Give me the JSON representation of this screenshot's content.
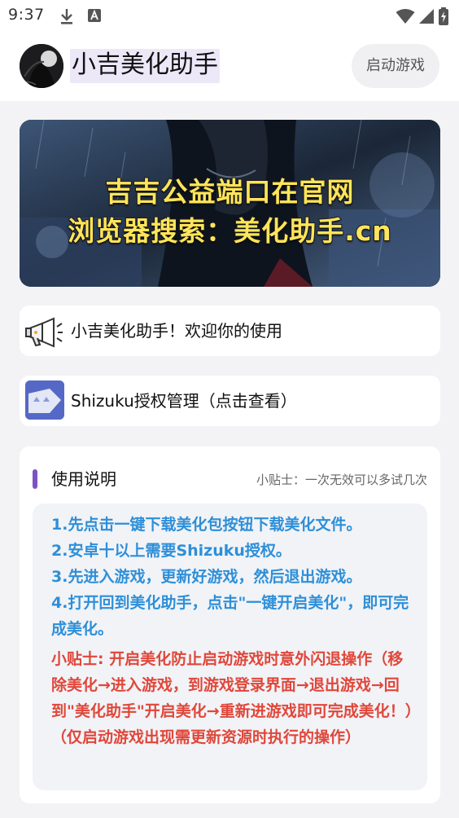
{
  "status_bar": {
    "time": "9:37",
    "icons": [
      "download-icon",
      "app-notification-icon",
      "wifi-icon",
      "signal-icon",
      "battery-icon"
    ]
  },
  "header": {
    "title": "小吉美化助手",
    "launch_button": "启动游戏"
  },
  "banner": {
    "line1": "吉吉公益端口在官网",
    "line2": "浏览器搜索：美化助手.cn"
  },
  "welcome_card": {
    "icon": "megaphone-icon",
    "text": "小吉美化助手！欢迎你的使用"
  },
  "shizuku_card": {
    "icon": "shizuku-icon",
    "text": "Shizuku授权管理（点击查看）"
  },
  "instructions": {
    "title": "使用说明",
    "tip": "小贴士：一次无效可以多试几次",
    "steps": [
      "1.先点击一键下载美化包按钮下载美化文件。",
      "2.安卓十以上需要Shizuku授权。",
      "3.先进入游戏，更新好游戏，然后退出游戏。",
      "4.打开回到美化助手，点击\"一键开启美化\"，即可完成美化。"
    ],
    "warning": "小贴士: 开启美化防止启动游戏时意外闪退操作（移除美化→进入游戏，到游戏登录界面→退出游戏→回到\"美化助手\"开启美化→重新进游戏即可完成美化！）（仅启动游戏出现需更新资源时执行的操作）"
  },
  "colors": {
    "accent_bar": "#7e52c4",
    "steps_text": "#2e8fd8",
    "warning_text": "#e0473a",
    "banner_text": "#ffe55a"
  }
}
